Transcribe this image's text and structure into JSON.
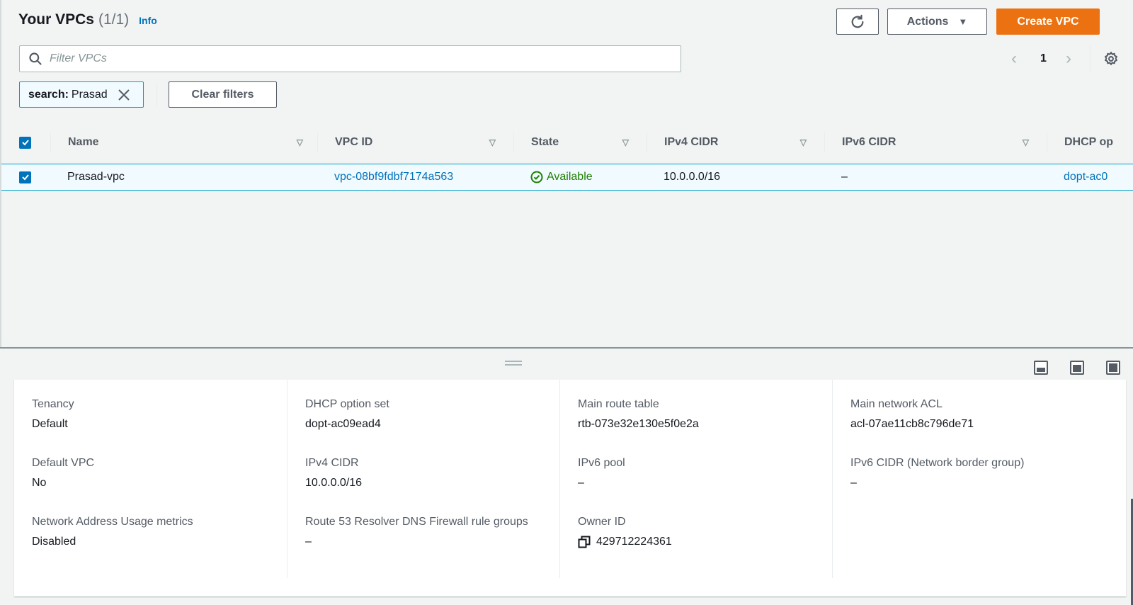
{
  "header": {
    "title": "Your VPCs",
    "count": "(1/1)",
    "info_label": "Info",
    "refresh_icon": "refresh-icon",
    "actions_label": "Actions",
    "create_label": "Create VPC"
  },
  "filter": {
    "placeholder": "Filter VPCs",
    "value": "",
    "token_key": "search:",
    "token_value": "Prasad",
    "clear_label": "Clear filters"
  },
  "pagination": {
    "current_page": "1"
  },
  "table": {
    "columns": [
      {
        "label": "Name"
      },
      {
        "label": "VPC ID"
      },
      {
        "label": "State"
      },
      {
        "label": "IPv4 CIDR"
      },
      {
        "label": "IPv6 CIDR"
      },
      {
        "label": "DHCP op"
      }
    ],
    "rows": [
      {
        "selected": true,
        "name": "Prasad-vpc",
        "vpc_id": "vpc-08bf9fdbf7174a563",
        "state": "Available",
        "ipv4_cidr": "10.0.0.0/16",
        "ipv6_cidr": "–",
        "dhcp": "dopt-ac0"
      }
    ]
  },
  "details": {
    "columns": [
      [
        {
          "label": "Tenancy",
          "value": "Default"
        },
        {
          "label": "Default VPC",
          "value": "No"
        },
        {
          "label": "Network Address Usage metrics",
          "value": "Disabled"
        }
      ],
      [
        {
          "label": "DHCP option set",
          "value": "dopt-ac09ead4"
        },
        {
          "label": "IPv4 CIDR",
          "value": "10.0.0.0/16"
        },
        {
          "label": "Route 53 Resolver DNS Firewall rule groups",
          "value": "–"
        }
      ],
      [
        {
          "label": "Main route table",
          "value": "rtb-073e32e130e5f0e2a"
        },
        {
          "label": "IPv6 pool",
          "value": "–"
        },
        {
          "label": "Owner ID",
          "value": "429712224361"
        }
      ],
      [
        {
          "label": "Main network ACL",
          "value": "acl-07ae11cb8c796de71"
        },
        {
          "label": "IPv6 CIDR (Network border group)",
          "value": "–"
        }
      ]
    ]
  },
  "colors": {
    "primary": "#ec7211",
    "link": "#0073bb",
    "success": "#1d8102",
    "selected_row_bg": "#f1faff",
    "selected_border": "#00a1c9"
  }
}
